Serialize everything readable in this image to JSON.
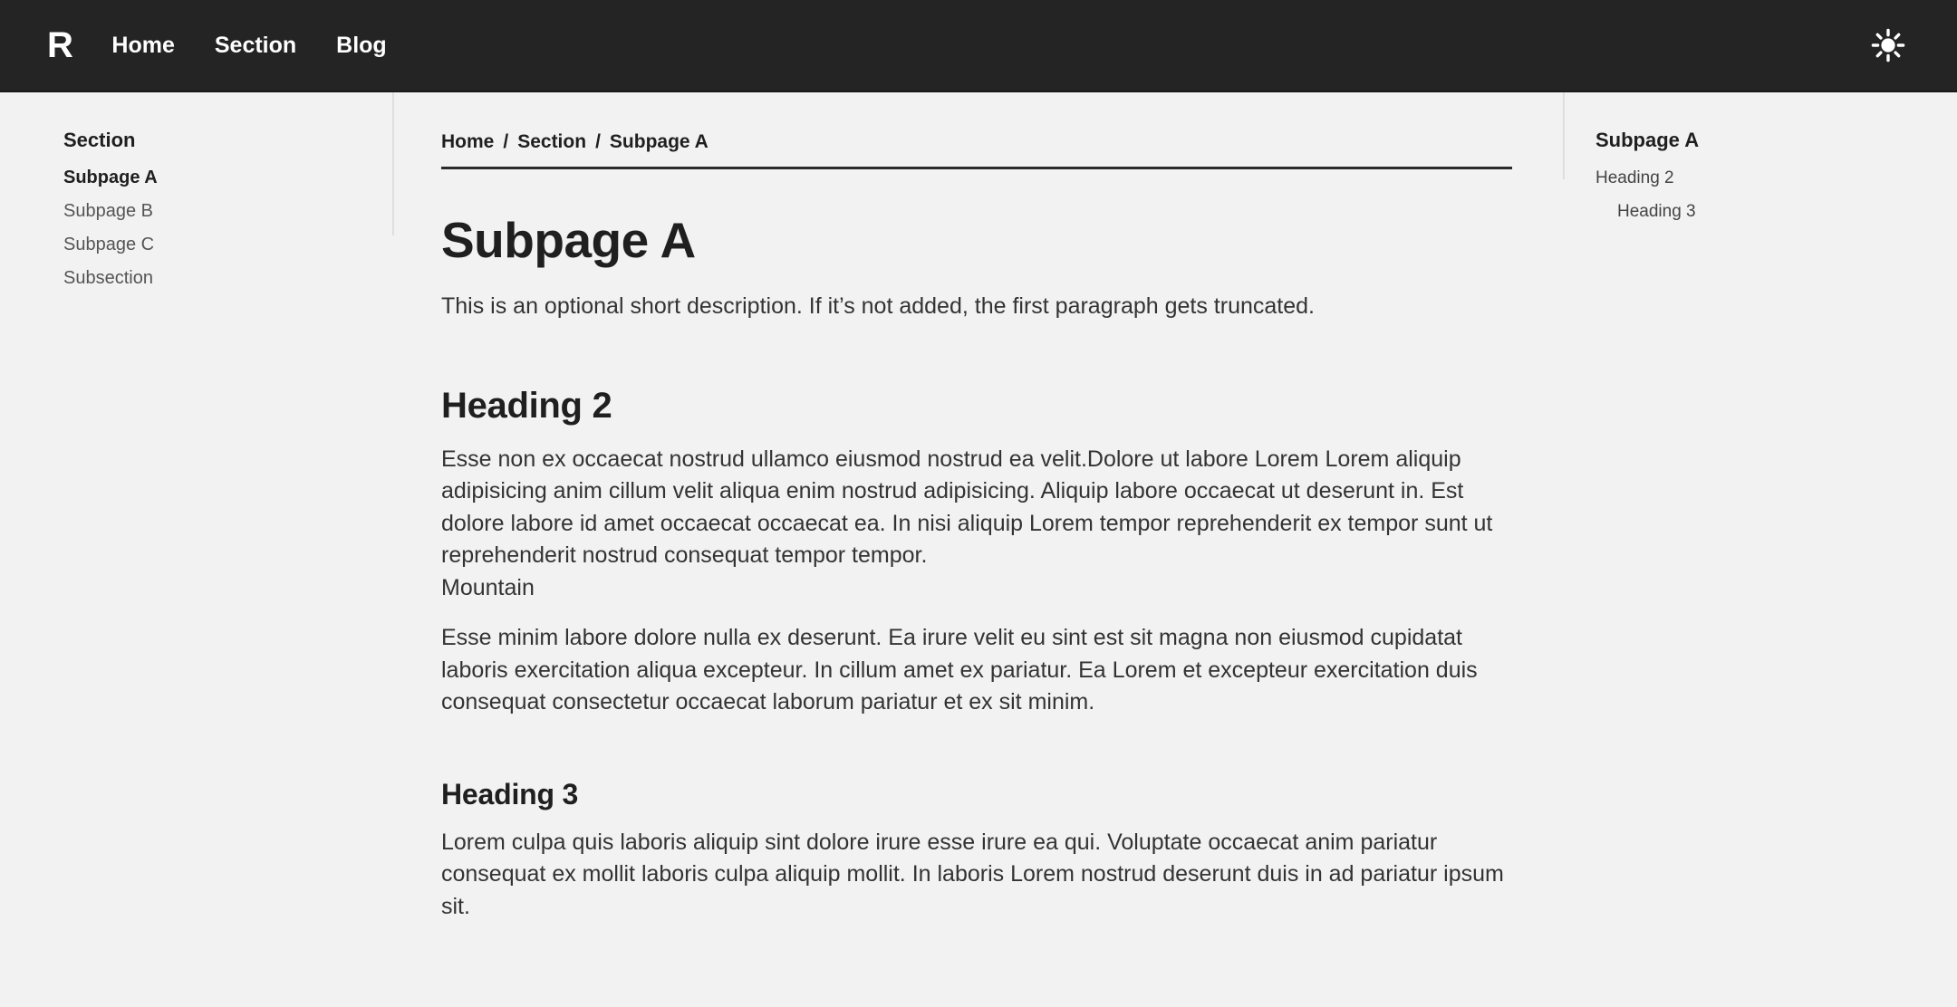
{
  "navbar": {
    "brand": "R",
    "links": [
      {
        "label": "Home"
      },
      {
        "label": "Section"
      },
      {
        "label": "Blog"
      }
    ],
    "theme_toggle_icon": "sun-icon",
    "background_color": "#242424",
    "text_color": "#ffffff"
  },
  "left_sidebar": {
    "heading": "Section",
    "items": [
      {
        "label": "Subpage A",
        "active": true
      },
      {
        "label": "Subpage B",
        "active": false
      },
      {
        "label": "Subpage C",
        "active": false
      },
      {
        "label": "Subsection",
        "active": false
      }
    ]
  },
  "breadcrumb": {
    "separator": "/",
    "items": [
      {
        "label": "Home"
      },
      {
        "label": "Section"
      },
      {
        "label": "Subpage A"
      }
    ]
  },
  "main": {
    "title": "Subpage A",
    "description": "This is an optional short description. If it’s not added, the first paragraph gets truncated.",
    "heading2": "Heading 2",
    "paragraph1": "Esse non ex occaecat nostrud ullamco eiusmod nostrud ea velit.Dolore ut labore Lorem Lorem aliquip adipisicing anim cillum velit aliqua enim nostrud adipisicing. Aliquip labore occaecat ut deserunt in. Est dolore labore id amet occaecat occaecat ea. In nisi aliquip Lorem tempor reprehenderit ex tempor sunt ut reprehenderit nostrud consequat tempor tempor.",
    "figure_caption": "Mountain",
    "paragraph2": "Esse minim labore dolore nulla ex deserunt. Ea irure velit eu sint est sit magna non eiusmod cupidatat laboris exercitation aliqua excepteur. In cillum amet ex pariatur. Ea Lorem et excepteur exercitation duis consequat consectetur occaecat laborum pariatur et ex sit minim.",
    "heading3": "Heading 3",
    "paragraph3": "Lorem culpa quis laboris aliquip sint dolore irure esse irure ea qui. Voluptate occaecat anim pariatur consequat ex mollit laboris culpa aliquip mollit. In laboris Lorem nostrud deserunt duis in ad pariatur ipsum sit."
  },
  "toc": {
    "title": "Subpage A",
    "items": [
      {
        "label": "Heading 2",
        "level": 2
      },
      {
        "label": "Heading 3",
        "level": 3
      }
    ]
  },
  "theme": {
    "page_background": "#f2f2f2",
    "body_text": "#333333",
    "heading_text": "#1f1f1f",
    "divider": "#dedede",
    "rule": "#2b2b2b"
  }
}
